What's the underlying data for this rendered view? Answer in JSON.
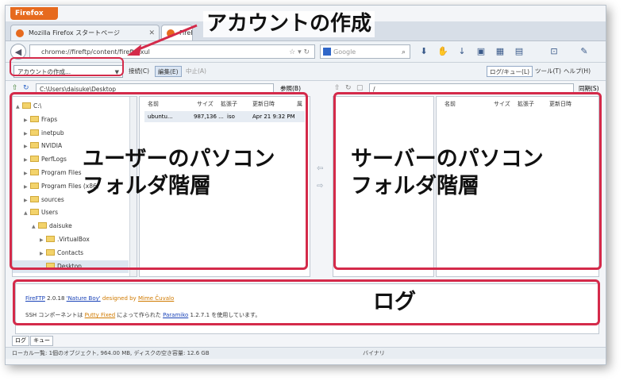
{
  "browser": {
    "menu_button": "Firefox",
    "tabs": [
      {
        "label": "Mozilla Firefox スタートページ"
      },
      {
        "label": "FireF"
      }
    ],
    "address": "chrome://fireftp/content/fireftp.xul",
    "search_placeholder": "Google"
  },
  "toolbar": {
    "account_select": "アカウントの作成...",
    "connect_label": "接続(C)",
    "edit_label": "編集(E)",
    "abort_label": "中止(A)",
    "log_queue_label": "ログ/キュー(L)",
    "tools_label": "ツール(T)",
    "help_label": "ヘルプ(H)"
  },
  "local": {
    "path": "C:\\Users\\daisuke\\Desktop",
    "browse_label": "参照(B)",
    "tree": [
      {
        "label": "C:\\",
        "level": 0,
        "expander": "▲"
      },
      {
        "label": "Fraps",
        "level": 1,
        "expander": "▶"
      },
      {
        "label": "inetpub",
        "level": 1,
        "expander": "▶"
      },
      {
        "label": "NVIDIA",
        "level": 1,
        "expander": "▶"
      },
      {
        "label": "PerfLogs",
        "level": 1,
        "expander": "▶"
      },
      {
        "label": "Program Files",
        "level": 1,
        "expander": "▶"
      },
      {
        "label": "Program Files (x86)",
        "level": 1,
        "expander": "▶"
      },
      {
        "label": "sources",
        "level": 1,
        "expander": "▶"
      },
      {
        "label": "Users",
        "level": 1,
        "expander": "▲"
      },
      {
        "label": "daisuke",
        "level": 2,
        "expander": "▲"
      },
      {
        "label": ".VirtualBox",
        "level": 3,
        "expander": "▶"
      },
      {
        "label": "Contacts",
        "level": 3,
        "expander": "▶"
      },
      {
        "label": "Desktop",
        "level": 3,
        "expander": "",
        "selected": true
      }
    ],
    "columns": [
      "名前",
      "サイズ",
      "拡張子",
      "更新日時",
      "属"
    ],
    "files": [
      {
        "name": "ubuntu...",
        "size": "987,136 ...",
        "ext": "iso",
        "date": "Apr 21 9:32 PM"
      }
    ]
  },
  "remote": {
    "path": "/",
    "browse_label": "同期(S)",
    "columns": [
      "名前",
      "サイズ",
      "拡張子",
      "更新日時"
    ]
  },
  "log": {
    "line1": {
      "product": "FireFTP",
      "version": "2.0.18",
      "release": "'Nature Boy'",
      "designed_by": "designed by",
      "designer": "Mime Čuvalo"
    },
    "line2": {
      "prefix": "SSH コンポーネントは",
      "author": "Putty Fixed",
      "middle": "によって作られた",
      "lib": "Paramiko",
      "suffix": "1.2.7.1 を使用しています。"
    }
  },
  "bottom_tabs": [
    "ログ",
    "キュー"
  ],
  "status": {
    "text": "ローカル一覧: 1個のオブジェクト, 964.00 MB, ディスクの空き容量: 12.6 GB",
    "mode": "バイナリ"
  },
  "annotations": {
    "account_create": "アカウントの作成",
    "user_folders": "ユーザーのパソコン\nフォルダ階層",
    "server_folders": "サーバーのパソコン\nフォルダ階層",
    "log": "ログ"
  },
  "colors": {
    "annotation_red": "#d42a4a",
    "firefox_orange": "#e66a1e"
  }
}
